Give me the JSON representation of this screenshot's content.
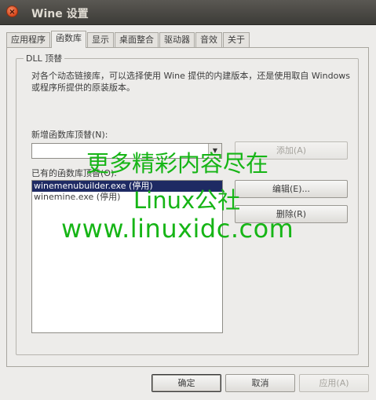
{
  "window": {
    "title": "Wine 设置",
    "close_glyph": "×"
  },
  "tabs": [
    {
      "label": "应用程序",
      "active": false
    },
    {
      "label": "函数库",
      "active": true
    },
    {
      "label": "显示",
      "active": false
    },
    {
      "label": "桌面整合",
      "active": false
    },
    {
      "label": "驱动器",
      "active": false
    },
    {
      "label": "音效",
      "active": false
    },
    {
      "label": "关于",
      "active": false
    }
  ],
  "dll_group": {
    "title": "DLL 顶替",
    "description": "对各个动态链接库，可以选择使用 Wine 提供的内建版本，还是使用取自 Windows 或程序所提供的原装版本。",
    "new_override_label": "新增函数库顶替(N):",
    "combo_value": "",
    "combo_arrow": "▼",
    "add_button": "添加(A)",
    "existing_label": "已有的函数库顶替(O):",
    "existing_items": [
      {
        "text": "winemenubuilder.exe (停用)",
        "selected": true
      },
      {
        "text": "winemine.exe (停用)",
        "selected": false
      }
    ],
    "edit_button": "编辑(E)...",
    "delete_button": "删除(R)"
  },
  "footer": {
    "ok_button": "确定",
    "cancel_button": "取消",
    "apply_button": "应用(A)"
  },
  "watermark": {
    "line1": "更多精彩内容尽在",
    "line2": "Linux公社",
    "line3": "www.linuxidc.com",
    "color": "#16b516"
  }
}
